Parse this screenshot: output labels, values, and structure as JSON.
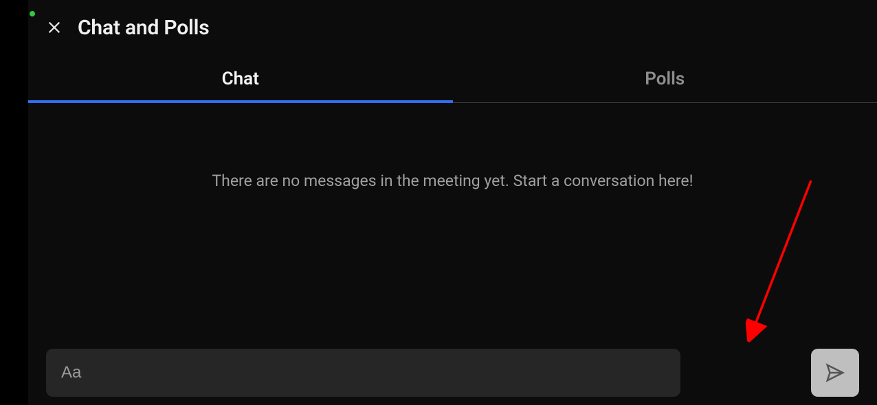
{
  "header": {
    "title": "Chat and Polls"
  },
  "tabs": {
    "chat": "Chat",
    "polls": "Polls",
    "active": "chat"
  },
  "content": {
    "empty_message": "There are no messages in the meeting yet. Start a conversation here!"
  },
  "input": {
    "placeholder": "Aa",
    "value": ""
  },
  "colors": {
    "accent": "#2f6fed",
    "status_dot": "#2ecc40",
    "annotation": "#ff0000"
  }
}
